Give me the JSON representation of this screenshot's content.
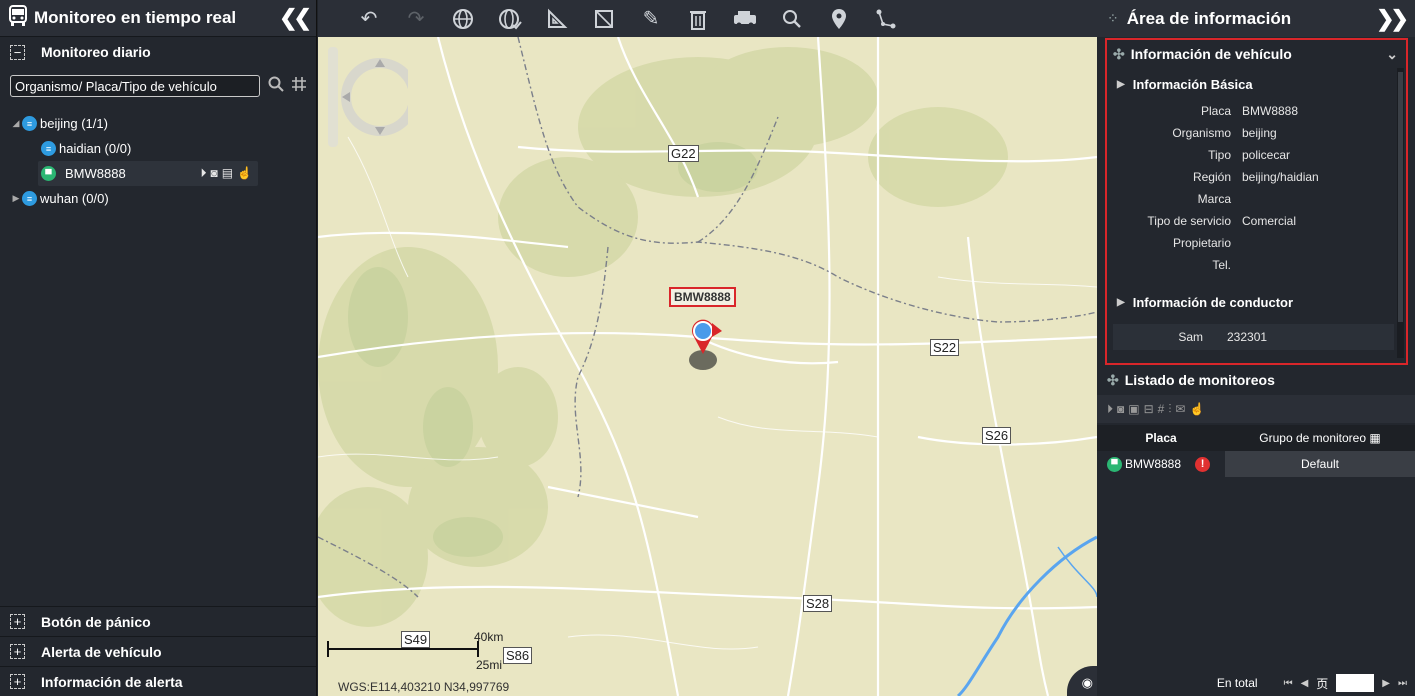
{
  "left_panel": {
    "title": "Monitoreo en tiempo real",
    "daily_section": "Monitoreo diario",
    "search_placeholder": "Organismo/ Placa/Tipo de vehículo",
    "tree": [
      {
        "label": "beijing (1/1)"
      },
      {
        "label": "haidian (0/0)"
      },
      {
        "label": "BMW8888"
      },
      {
        "label": "wuhan (0/0)"
      }
    ],
    "bottom_sections": [
      "Botón de pánico",
      "Alerta de vehículo",
      "Información de alerta"
    ]
  },
  "toolbar": {
    "icons": [
      "undo-icon",
      "redo-icon",
      "globe-icon",
      "globe-check-icon",
      "ruler-triangle-icon",
      "area-measure-icon",
      "pencil-icon",
      "trash-icon",
      "vehicle-icon",
      "search-icon",
      "location-pin-icon",
      "route-icon"
    ]
  },
  "map": {
    "road_labels": [
      "G22",
      "S22",
      "S26",
      "S28",
      "S49",
      "S86"
    ],
    "vehicle_label": "BMW8888",
    "scale_km": "40km",
    "scale_mi": "25mi",
    "coords": "WGS:E114,403210  N34,997769"
  },
  "right_panel": {
    "title": "Área de información",
    "vehicle_info_title": "Información de vehículo",
    "basic_info_title": "Información Básica",
    "basic_info": [
      {
        "k": "Placa",
        "v": "BMW8888"
      },
      {
        "k": "Organismo",
        "v": "beijing"
      },
      {
        "k": "Tipo",
        "v": "policecar"
      },
      {
        "k": "Región",
        "v": "beijing/haidian"
      },
      {
        "k": "Marca",
        "v": ""
      },
      {
        "k": "Tipo de servicio",
        "v": "Comercial"
      },
      {
        "k": "Propietario",
        "v": ""
      },
      {
        "k": "Tel.",
        "v": ""
      }
    ],
    "driver_info_title": "Información de conductor",
    "driver": {
      "k": "Sam",
      "v": "232301"
    },
    "monitor_list_title": "Listado de monitoreos",
    "table_headers": {
      "plate": "Placa",
      "group": "Grupo de monitoreo"
    },
    "rows": [
      {
        "plate": "BMW8888",
        "group": "Default"
      }
    ],
    "pager": {
      "total_label": "En total",
      "page_label": "页"
    }
  },
  "colors": {
    "highlight": "#d9262a",
    "panel": "#23272e",
    "map": "#e9e6c3"
  }
}
